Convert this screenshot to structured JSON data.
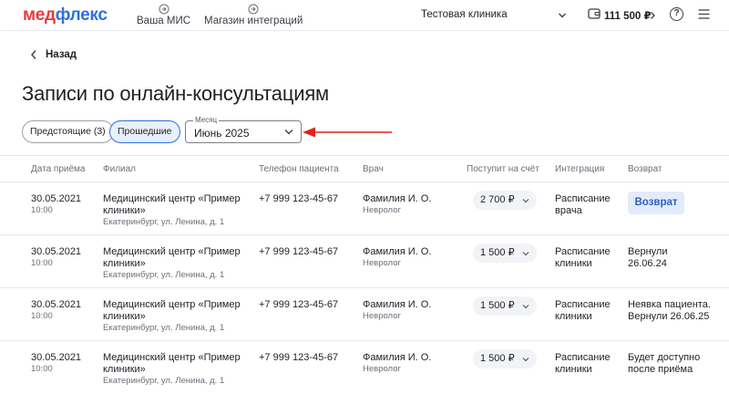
{
  "header": {
    "logo_part1": "мед",
    "logo_part2": "флекс",
    "nav": [
      {
        "label": "Ваша МИС"
      },
      {
        "label": "Магазин интеграций"
      }
    ],
    "clinic": "Тестовая клиника",
    "balance": "111 500 ₽"
  },
  "back_label": "Назад",
  "page_title": "Записи по онлайн-консультациям",
  "filters": {
    "upcoming": "Предстоящие (3)",
    "past": "Прошедшие",
    "month_label": "Месяц",
    "month_value": "Июнь 2025"
  },
  "table": {
    "columns": [
      "Дата приёма",
      "Филиал",
      "Телефон пациента",
      "Врач",
      "Поступит на счёт",
      "Интеграция",
      "Возврат"
    ],
    "rows": [
      {
        "date": "30.05.2021",
        "time": "10:00",
        "branch_line1": "Медицинский центр «Пример",
        "branch_line2": "клиники»",
        "address": "Екатеринбург, ул. Ленина, д. 1",
        "phone": "+7 999 123-45-67",
        "doctor": "Фамилия И. О.",
        "specialty": "Невролог",
        "amount": "2 700 ₽",
        "integration_line1": "Расписание",
        "integration_line2": "врача",
        "return_button": "Возврат"
      },
      {
        "date": "30.05.2021",
        "time": "10:00",
        "branch_line1": "Медицинский центр «Пример",
        "branch_line2": "клиники»",
        "address": "Екатеринбург, ул. Ленина, д. 1",
        "phone": "+7 999 123-45-67",
        "doctor": "Фамилия И. О.",
        "specialty": "Невролог",
        "amount": "1 500 ₽",
        "integration_line1": "Расписание",
        "integration_line2": "клиники",
        "return_line1": "Вернули",
        "return_line2": "26.06.24"
      },
      {
        "date": "30.05.2021",
        "time": "10:00",
        "branch_line1": "Медицинский центр «Пример",
        "branch_line2": "клиники»",
        "address": "Екатеринбург, ул. Ленина, д. 1",
        "phone": "+7 999 123-45-67",
        "doctor": "Фамилия И. О.",
        "specialty": "Невролог",
        "amount": "1 500 ₽",
        "integration_line1": "Расписание",
        "integration_line2": "клиники",
        "return_line1": "Неявка пациента.",
        "return_line2": "Вернули 26.06.25"
      },
      {
        "date": "30.05.2021",
        "time": "10:00",
        "branch_line1": "Медицинский центр «Пример",
        "branch_line2": "клиники»",
        "address": "Екатеринбург, ул. Ленина, д. 1",
        "phone": "+7 999 123-45-67",
        "doctor": "Фамилия И. О.",
        "specialty": "Невролог",
        "amount": "1 500 ₽",
        "integration_line1": "Расписание",
        "integration_line2": "клиники",
        "return_line1": "Будет доступно",
        "return_line2": "после приёма"
      }
    ]
  },
  "colors": {
    "logo_red": "#e8383d",
    "logo_blue": "#2f6fe0",
    "accent": "#2f6fe0",
    "annotation_arrow": "#e2231a"
  },
  "icons": {
    "nav": "login-arrow-icon",
    "wallet": "wallet-icon",
    "help": "help-circle-icon",
    "menu": "hamburger-menu-icon",
    "back": "chevron-left-icon"
  }
}
